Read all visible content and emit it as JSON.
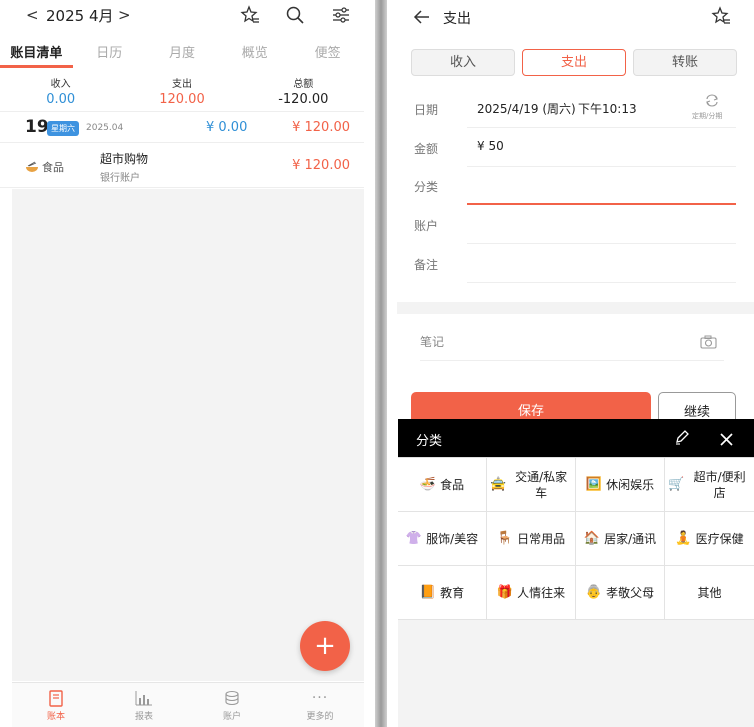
{
  "left": {
    "header": {
      "prev": "<",
      "month": "2025 4月",
      "next": ">"
    },
    "tabs": [
      "账目清单",
      "日历",
      "月度",
      "概览",
      "便签"
    ],
    "summary": [
      {
        "label": "收入",
        "value": "0.00"
      },
      {
        "label": "支出",
        "value": "120.00"
      },
      {
        "label": "总额",
        "value": "-120.00"
      }
    ],
    "day": {
      "num": "19",
      "weekday": "星期六",
      "date": "2025.04",
      "income": "¥ 0.00",
      "expense": "¥ 120.00"
    },
    "entry": {
      "category": "食品",
      "title": "超市购物",
      "account": "银行账户",
      "amount": "¥ 120.00"
    },
    "fab": "+",
    "bottom_nav": [
      "账本",
      "报表",
      "账户",
      "更多的"
    ]
  },
  "right": {
    "title": "支出",
    "segments": [
      "收入",
      "支出",
      "转账"
    ],
    "form": {
      "date_label": "日期",
      "date_value": "2025/4/19 (周六)",
      "time_value": "下午10:13",
      "recurring_label": "定期/分期",
      "amount_label": "金额",
      "amount_value": "¥ 50",
      "category_label": "分类",
      "account_label": "账户",
      "remark_label": "备注"
    },
    "note_label": "笔记",
    "save": "保存",
    "continue": "继续",
    "sheet": {
      "title": "分类",
      "categories": [
        {
          "icon": "🍜",
          "label": "食品"
        },
        {
          "icon": "🚖",
          "label": "交通/私家车"
        },
        {
          "icon": "🖼️",
          "label": "休闲娱乐"
        },
        {
          "icon": "🛒",
          "label": "超市/便利店"
        },
        {
          "icon": "👚",
          "label": "服饰/美容"
        },
        {
          "icon": "🪑",
          "label": "日常用品"
        },
        {
          "icon": "🏠",
          "label": "居家/通讯"
        },
        {
          "icon": "🧘",
          "label": "医疗保健"
        },
        {
          "icon": "📙",
          "label": "教育"
        },
        {
          "icon": "🎁",
          "label": "人情往来"
        },
        {
          "icon": "👵",
          "label": "孝敬父母"
        },
        {
          "icon": "",
          "label": "其他"
        }
      ]
    }
  }
}
